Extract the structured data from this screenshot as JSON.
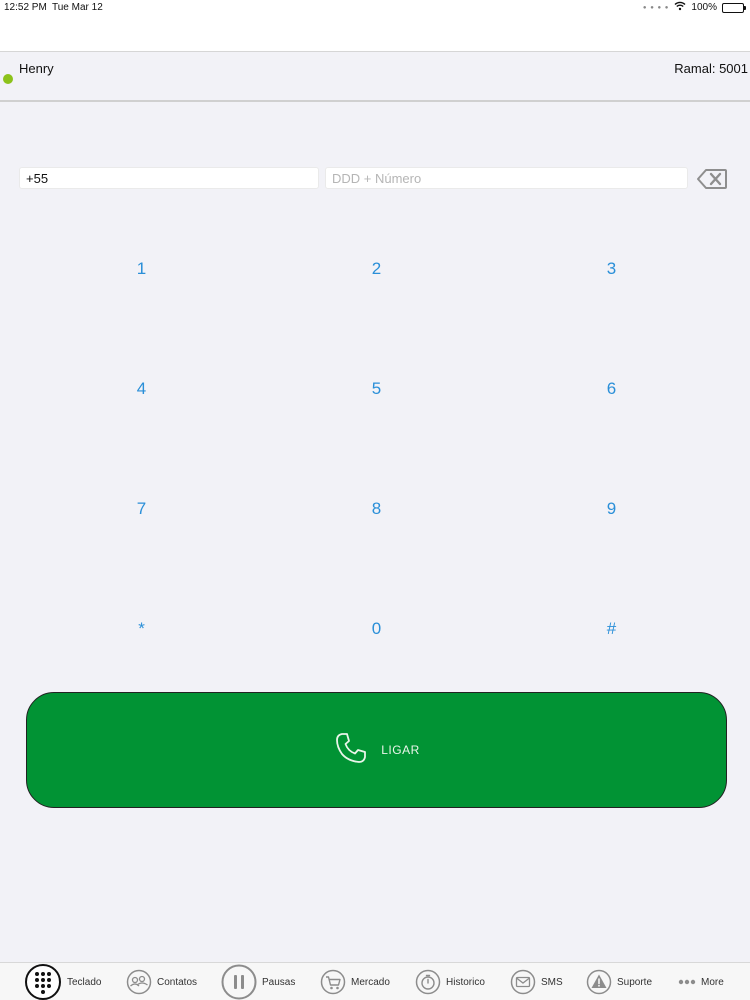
{
  "status_bar": {
    "time": "12:52 PM",
    "date": "Tue Mar 12",
    "battery": "100%"
  },
  "user_bar": {
    "name": "Henry",
    "extension": "Ramal: 5001",
    "status_color": "#8cc21b"
  },
  "dialer": {
    "country_code": "+55",
    "number_placeholder": "DDD + Número",
    "number_value": "",
    "keys": [
      "1",
      "2",
      "3",
      "4",
      "5",
      "6",
      "7",
      "8",
      "9",
      "*",
      "0",
      "#"
    ],
    "key_color": "#2a8fd8"
  },
  "call_button": {
    "label": "LIGAR",
    "color": "#019334",
    "icon": "phone-icon"
  },
  "tab_bar": {
    "tabs": [
      {
        "label": "Teclado",
        "icon": "keypad-icon",
        "selected": true
      },
      {
        "label": "Contatos",
        "icon": "contacts-icon"
      },
      {
        "label": "Pausas",
        "icon": "pause-icon"
      },
      {
        "label": "Mercado",
        "icon": "cart-icon"
      },
      {
        "label": "Historico",
        "icon": "history-icon"
      },
      {
        "label": "SMS",
        "icon": "envelope-icon"
      },
      {
        "label": "Suporte",
        "icon": "warning-icon"
      },
      {
        "label": "More",
        "icon": "more-icon"
      }
    ]
  }
}
